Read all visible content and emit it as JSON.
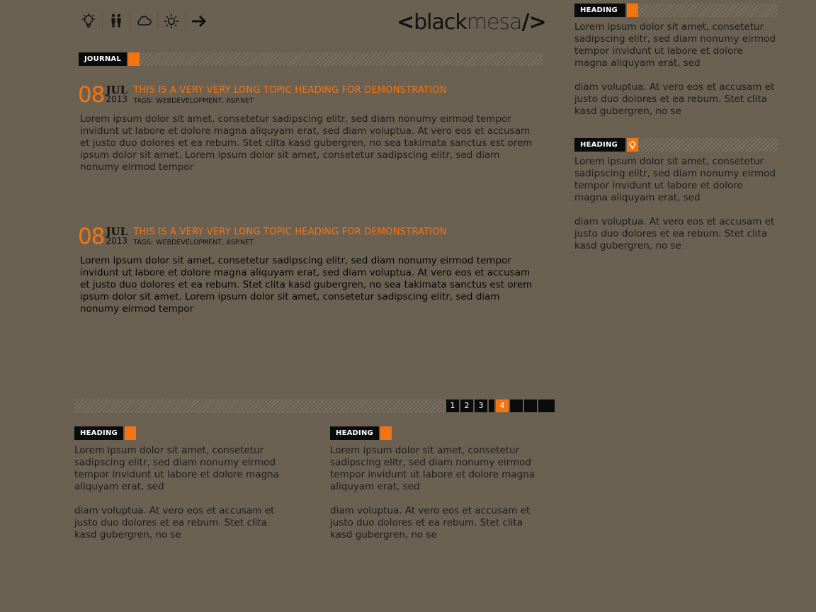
{
  "toolbar": {
    "icons": [
      "lightbulb-icon",
      "people-icon",
      "cloud-icon",
      "sun-icon",
      "arrow-right-icon"
    ]
  },
  "logo": {
    "left": "<",
    "black": "black",
    "mesa": "mesa",
    "right": "/>"
  },
  "journal": {
    "label": "JOURNAL"
  },
  "posts": [
    {
      "day": "08",
      "month": "JUL",
      "year": "2013",
      "title": "THIS IS A VERY VERY LONG TOPIC HEADING FOR DEMONSTRATION",
      "tags_label": "TAGS:",
      "tags": "WEBDEVELOPMENT, ASP.NET",
      "body1": "Lorem ipsum dolor sit amet, consetetur sadipscing elitr, sed diam nonumy eirmod tempor invidunt ut labore et dolore magna aliquyam erat, sed diam voluptua. At vero eos et accusam",
      "body2": "et justo duo dolores et ea rebum. Stet clita kasd gubergren, no sea takimata sanctus est orem ipsum dolor sit amet. Lorem ipsum dolor sit amet, consetetur sadipscing elitr, sed diam nonumy eirmod tempor"
    },
    {
      "day": "08",
      "month": "JUL",
      "year": "2013",
      "title": "THIS IS A VERY VERY LONG TOPIC HEADING FOR DEMONSTRATION",
      "tags_label": "TAGS:",
      "tags": "WEBDEVELOPMENT, ASP.NET",
      "body1": "Lorem ipsum dolor sit amet, consetetur sadipscing elitr, sed diam nonumy eirmod tempor invidunt ut labore et dolore magna aliquyam erat, sed diam voluptua. At vero eos et accusam",
      "body2": "et justo duo dolores et ea rebum. Stet clita kasd gubergren, no sea takimata sanctus est orem ipsum dolor sit amet. Lorem ipsum dolor sit amet, consetetur sadipscing elitr, sed diam nonumy eirmod tempor"
    }
  ],
  "pagination": {
    "pages": [
      "1",
      "2",
      "3",
      "",
      "4",
      "",
      "",
      ""
    ],
    "active": "4"
  },
  "sidebar": [
    {
      "heading": "HEADING",
      "p1": "Lorem ipsum dolor sit amet, consetetur sadipscing elitr, sed diam nonumy eirmod tempor invidunt ut labore et dolore magna aliquyam erat, sed",
      "p2": "diam voluptua. At vero eos et accusam et justo duo dolores et ea rebum. Stet clita kasd gubergren, no se"
    },
    {
      "heading": "HEADING",
      "icon": "lightbulb-icon",
      "p1": "Lorem ipsum dolor sit amet, consetetur sadipscing elitr, sed diam nonumy eirmod tempor invidunt ut labore et dolore magna aliquyam erat, sed",
      "p2": "diam voluptua. At vero eos et accusam et justo duo dolores et ea rebum. Stet clita kasd gubergren, no se"
    }
  ],
  "bottom": [
    {
      "heading": "HEADING",
      "p1": "Lorem ipsum dolor sit amet, consetetur sadipscing elitr, sed diam nonumy eirmod tempor invidunt ut labore et dolore magna aliquyam erat, sed",
      "p2": "diam voluptua. At vero eos et accusam et justo duo dolores et ea rebum. Stet clita kasd gubergren, no se"
    },
    {
      "heading": "HEADING",
      "p1": "Lorem ipsum dolor sit amet, consetetur sadipscing elitr, sed diam nonumy eirmod tempor invidunt ut labore et dolore magna aliquyam erat, sed",
      "p2": "diam voluptua. At vero eos et accusam et justo duo dolores et ea rebum. Stet clita kasd gubergren, no se"
    }
  ],
  "colors": {
    "background": "#6b6152",
    "accent": "#f57410",
    "bar": "#0b0b0b"
  }
}
